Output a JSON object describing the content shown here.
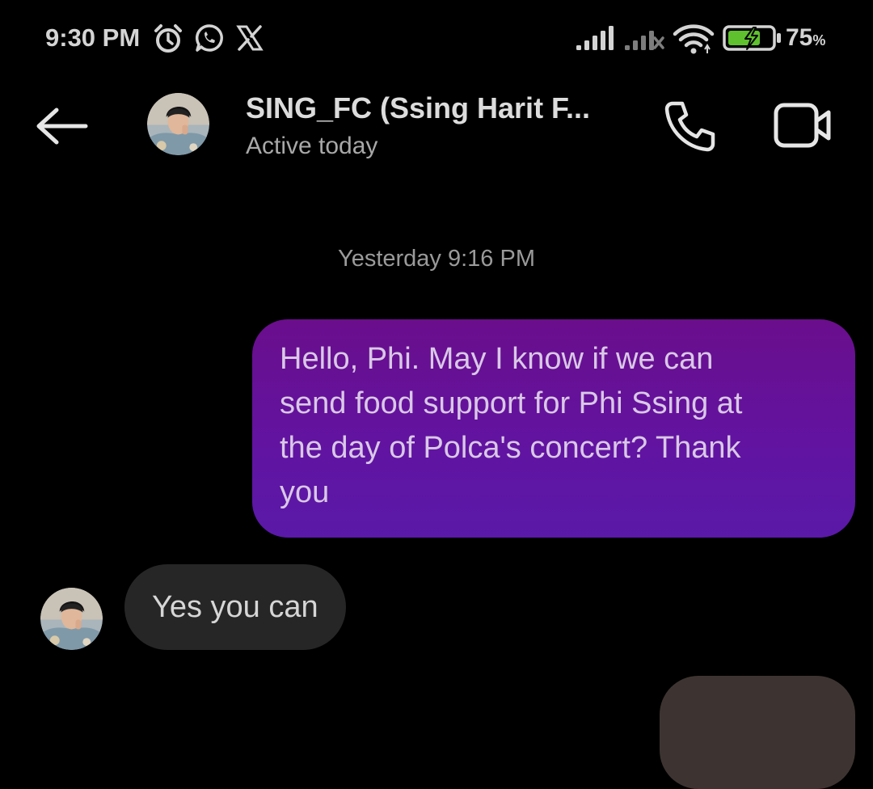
{
  "status_bar": {
    "time": "9:30 PM",
    "icons_left": [
      "alarm-icon",
      "whatsapp-icon",
      "x-app-icon"
    ],
    "icons_right": [
      "signal-icon",
      "signal-no-service-icon",
      "wifi-icon",
      "battery-charging-icon"
    ],
    "battery_value": "75",
    "battery_unit": "%",
    "battery_fill_level": 0.75
  },
  "header": {
    "contact_name": "SING_FC (Ssing Harit F...",
    "contact_status": "Active today",
    "icons": [
      "back-arrow-icon",
      "phone-icon",
      "video-camera-icon"
    ]
  },
  "conversation": {
    "timestamp": "Yesterday 9:16 PM",
    "messages": [
      {
        "direction": "outgoing",
        "lines": [
          "Hello, Phi. May I know if we can",
          "send food support for Phi Ssing at",
          "the day of Polca's concert? Thank",
          "you"
        ]
      },
      {
        "direction": "incoming",
        "text": "Yes you can"
      }
    ]
  },
  "colors": {
    "background": "#000000",
    "outgoing_bubble": "#6213a0",
    "incoming_bubble": "#262626",
    "battery_accent": "#5fc12e"
  }
}
